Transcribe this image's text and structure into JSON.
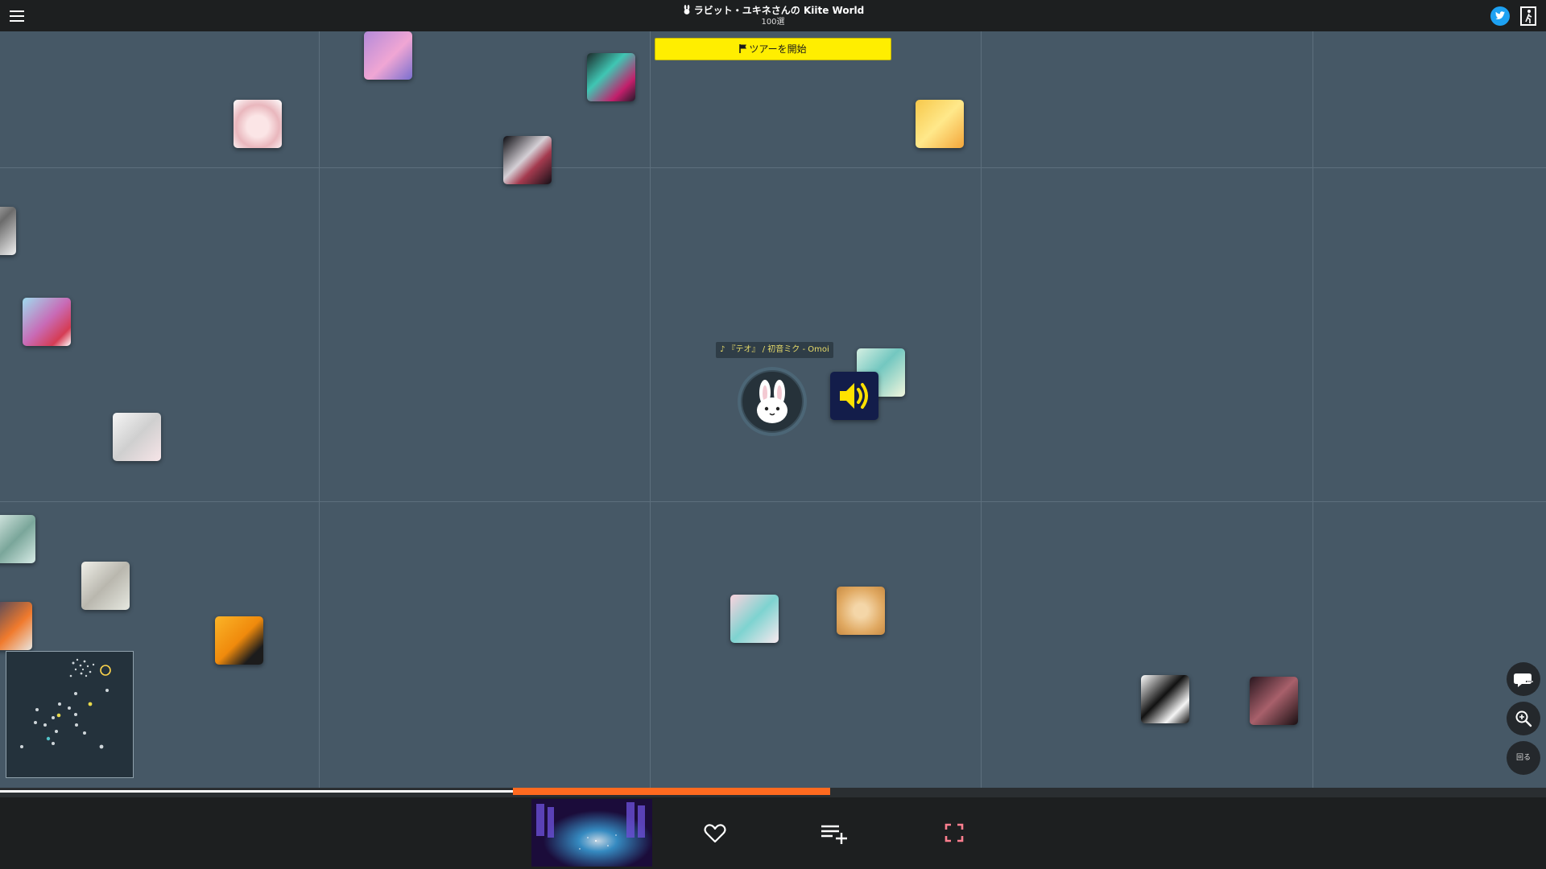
{
  "header": {
    "title": "ラビット・ユキネさんの Kiite World",
    "subtitle": "100選",
    "icons": [
      "menu-icon",
      "rabbit-icon",
      "twitter-icon",
      "exit-icon"
    ]
  },
  "map": {
    "tour_button_label": "ツアーを開始",
    "now_playing_label": "♪ 『テオ』 / 初音ミク - Omoi",
    "side_buttons": {
      "comment_icon": "comment-icon",
      "zoom_icon": "zoom-icon",
      "rotate_label": "回る"
    }
  },
  "progress": {
    "listened_fraction": 0.39,
    "buffered_start_fraction": 0.332,
    "buffered_end_fraction": 0.537
  },
  "player": {
    "icons": [
      "heart-icon",
      "playlist-add-icon",
      "fullscreen-icon"
    ]
  },
  "colors": {
    "accent": "#ffee00",
    "progress": "#ff6a1f",
    "twitter": "#1da1f2",
    "map_background": "#465866"
  }
}
